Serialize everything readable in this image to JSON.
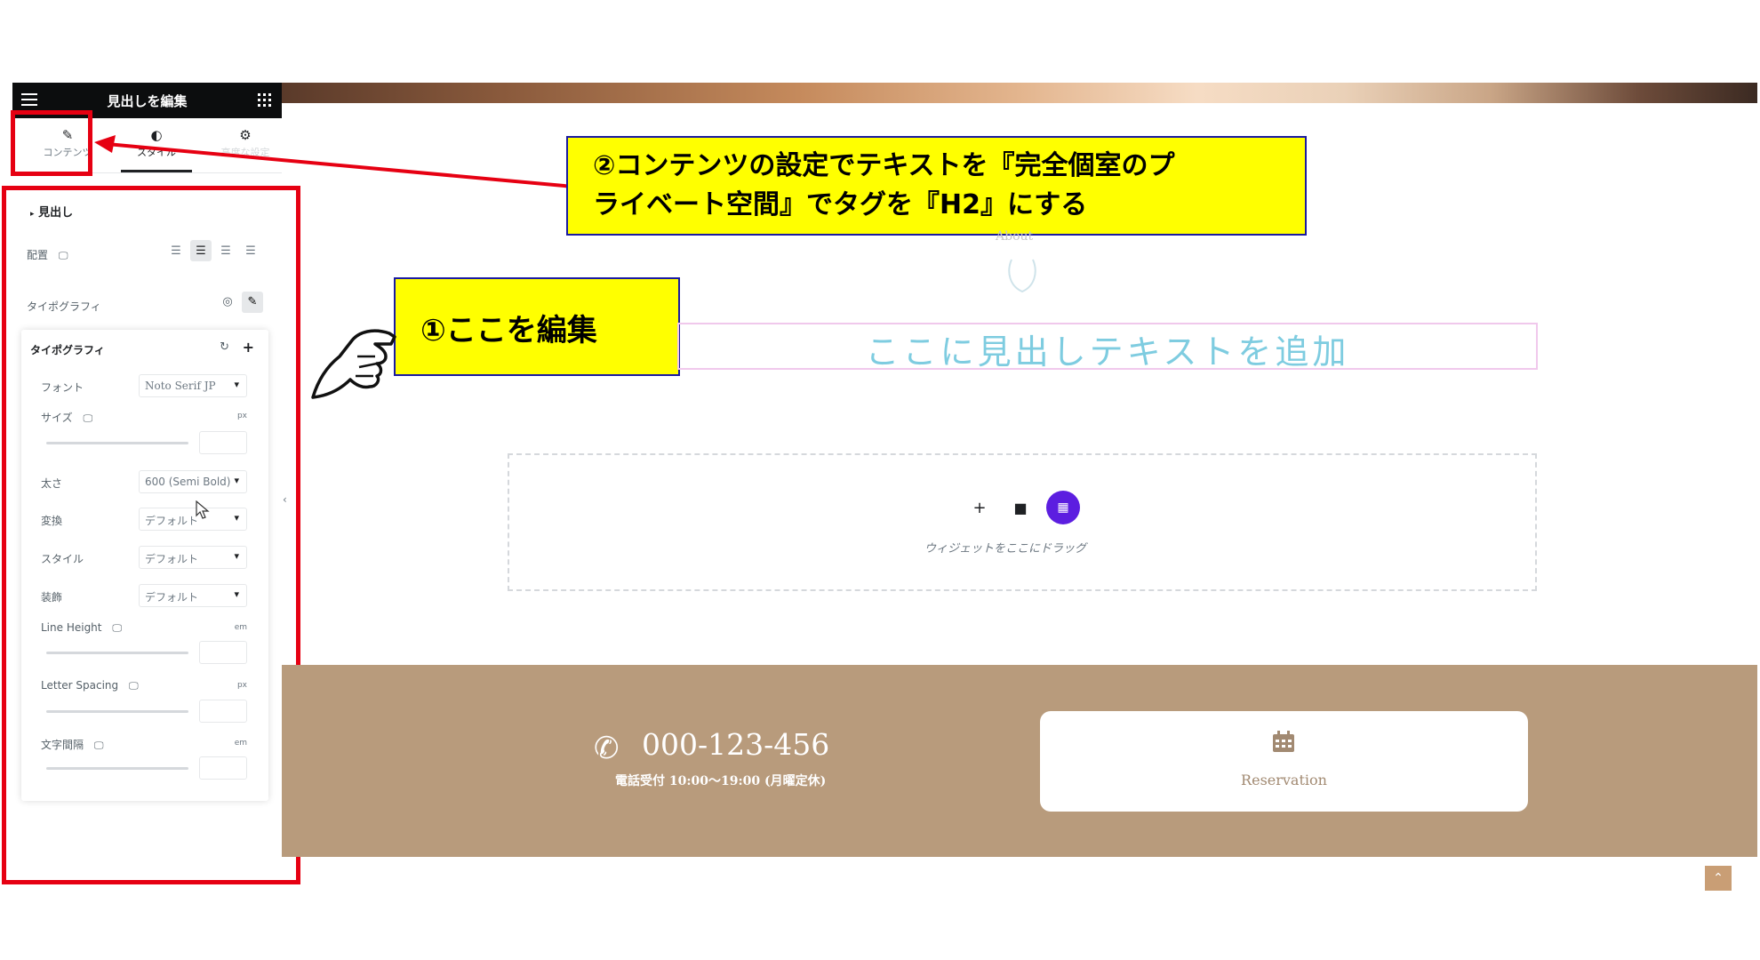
{
  "editor": {
    "header_title": "見出しを編集",
    "tabs": [
      {
        "label": "コンテンツ",
        "icon": "pencil-icon"
      },
      {
        "label": "スタイル",
        "icon": "half-circle-icon"
      },
      {
        "label": "高度な設定",
        "icon": "gear-icon"
      }
    ],
    "section_title": "見出し",
    "alignment_label": "配置",
    "typography_label": "タイポグラフィ",
    "typo_card": {
      "title": "タイポグラフィ",
      "font_label": "フォント",
      "font_value": "Noto Serif JP",
      "size_label": "サイズ",
      "size_unit": "px",
      "weight_label": "太さ",
      "weight_value": "600 (Semi Bold)",
      "transform_label": "変換",
      "transform_value": "デフォルト",
      "style_label": "スタイル",
      "style_value": "デフォルト",
      "decoration_label": "装飾",
      "decoration_value": "デフォルト",
      "line_height_label": "Line Height",
      "line_height_unit": "em",
      "letter_spacing_label": "Letter Spacing",
      "letter_spacing_unit": "px",
      "word_spacing_label": "文字間隔",
      "word_spacing_unit": "em"
    }
  },
  "annotations": {
    "note1": "①ここを編集",
    "note2_line1": "②コンテンツの設定でテキストを『完全個室のプ",
    "note2_line2": "ライベート空間』でタグを『H2』にする",
    "highlight_color": "#e60012",
    "note_bg": "#ffff00"
  },
  "canvas": {
    "about_label": "About",
    "heading_text": "ここに見出しテキストを追加",
    "dropzone_text": "ウィジェットをここにドラッグ"
  },
  "footer": {
    "phone": "000-123-456",
    "hours": "電話受付 10:00〜19:00 (月曜定休)",
    "reservation": "Reservation",
    "band_color": "#b89b7c"
  }
}
